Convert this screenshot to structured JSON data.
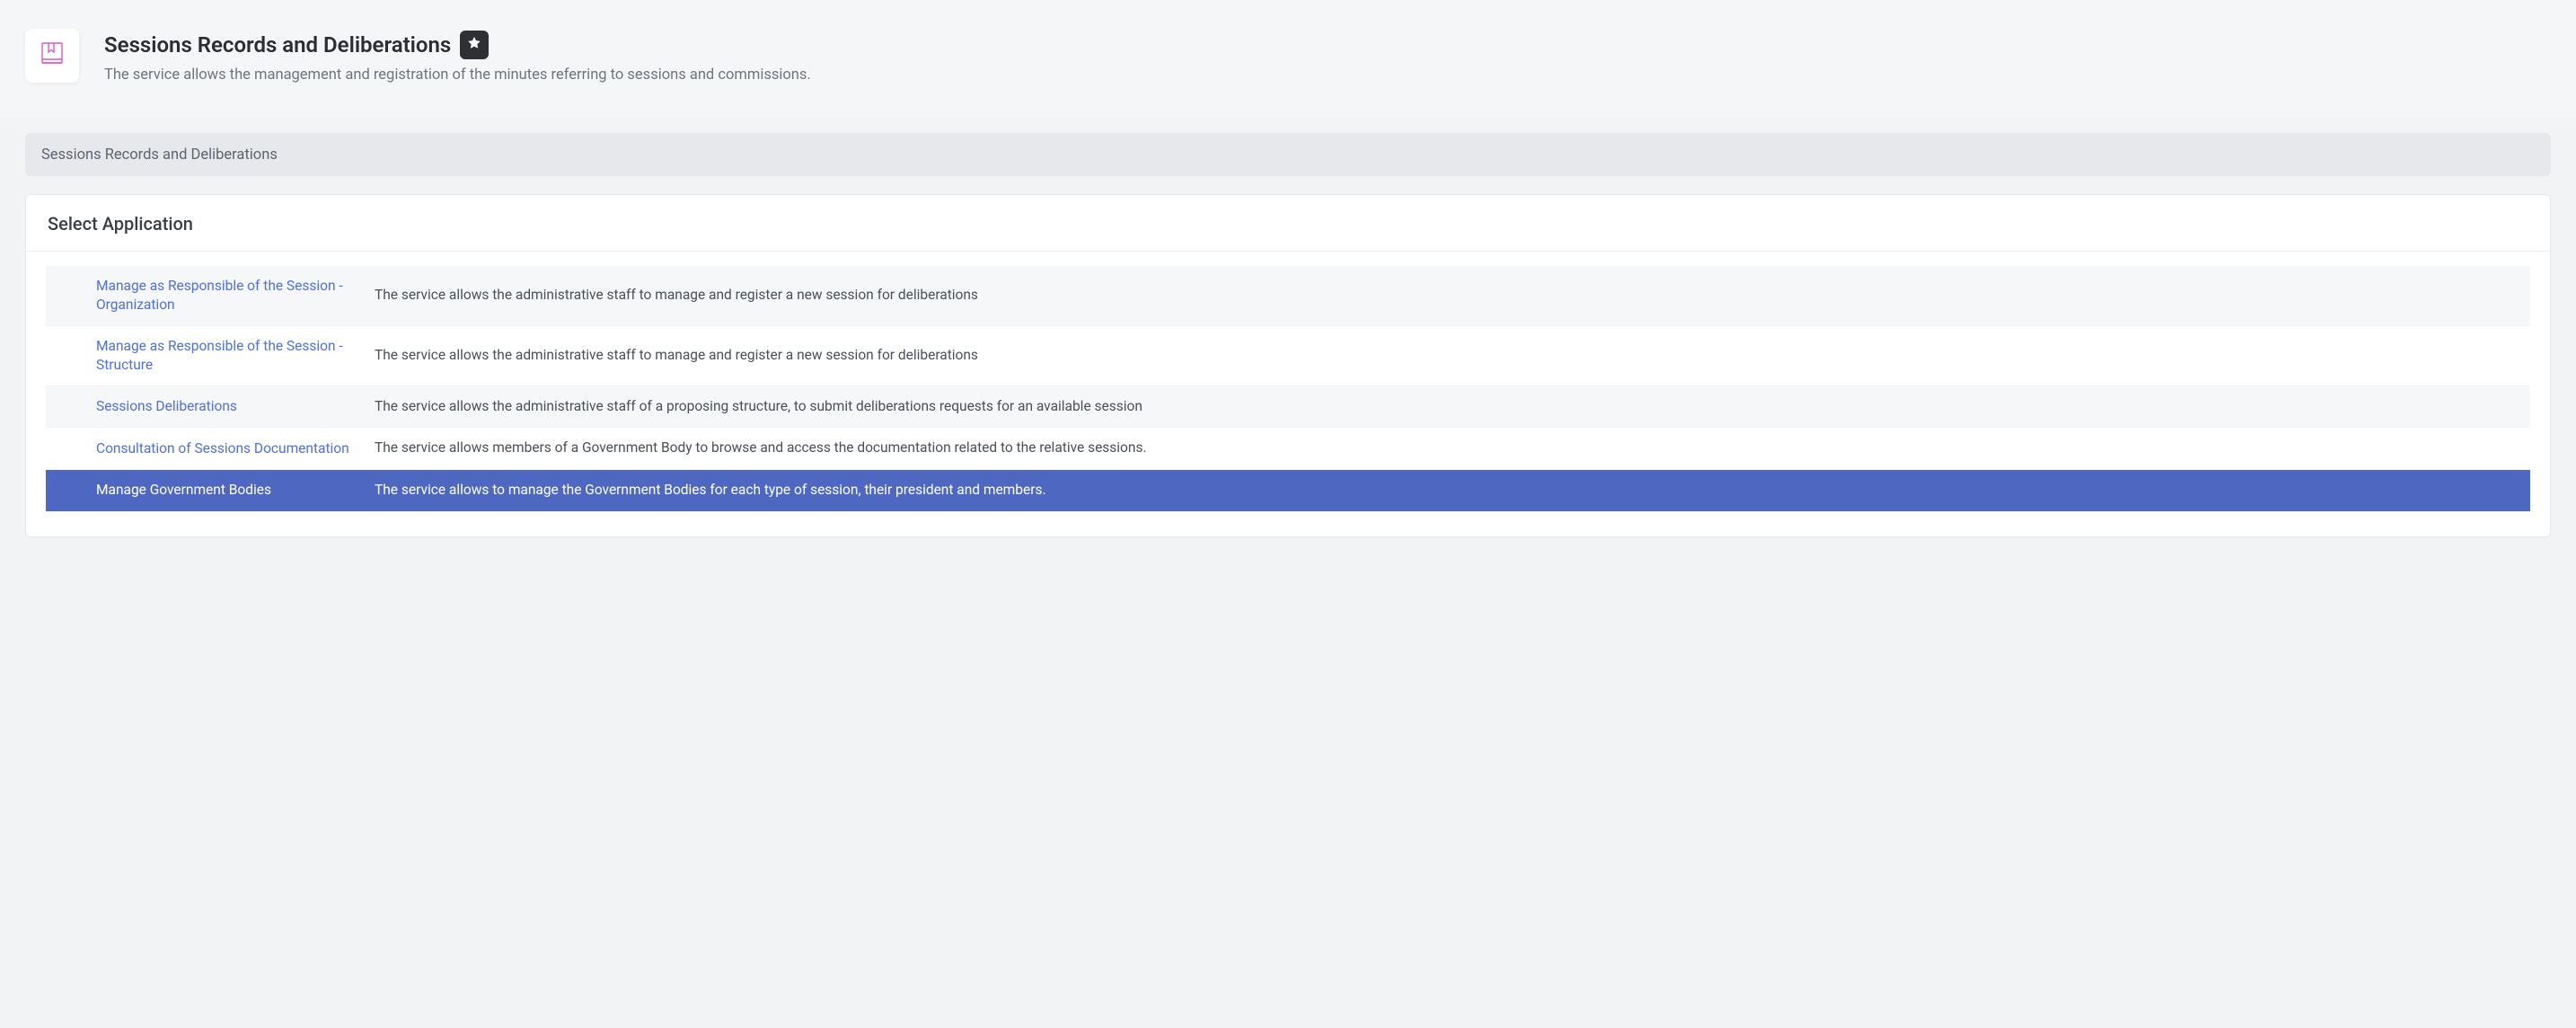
{
  "header": {
    "title": "Sessions Records and Deliberations",
    "subtitle": "The service allows the management and registration of the minutes referring to sessions and commissions.",
    "icon_name": "bookmark-book-icon"
  },
  "breadcrumb": {
    "text": "Sessions Records and Deliberations"
  },
  "panel": {
    "title": "Select Application"
  },
  "apps": [
    {
      "link": "Manage as Responsible of the Session - Organization",
      "desc": "The service allows the administrative staff to manage and register a new session for deliberations"
    },
    {
      "link": "Manage as Responsible of the Session - Structure",
      "desc": "The service allows the administrative staff to manage and register a new session for deliberations"
    },
    {
      "link": "Sessions Deliberations",
      "desc": "The service allows the administrative staff of a proposing structure, to submit deliberations requests for an available session"
    },
    {
      "link": "Consultation of Sessions Documentation",
      "desc": "The service allows members of a Government Body to browse and access the documentation related to the relative sessions."
    },
    {
      "link": "Manage Government Bodies",
      "desc": "The service allows to manage the Government Bodies for each type of session, their president and members."
    }
  ]
}
